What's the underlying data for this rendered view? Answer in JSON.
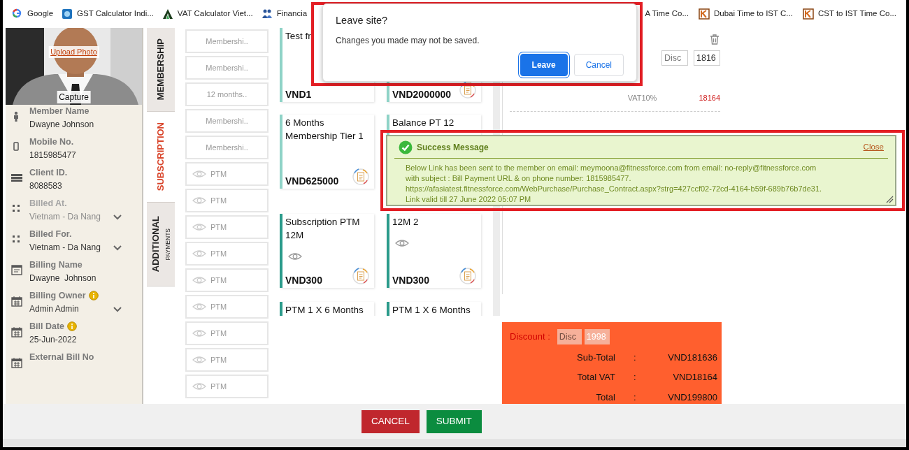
{
  "bookmarks": {
    "before_dialog": [
      {
        "label": "Google",
        "kind": "g"
      },
      {
        "label": "GST Calculator Indi...",
        "kind": "badge"
      },
      {
        "label": "VAT Calculator Viet...",
        "kind": "triangle"
      },
      {
        "label": "Financia",
        "kind": "people"
      }
    ],
    "after_dialog": [
      {
        "label": "A Time Co...",
        "kind": "none"
      },
      {
        "label": "Dubai Time to IST C...",
        "kind": "square"
      },
      {
        "label": "CST to IST Time Co...",
        "kind": "square"
      }
    ]
  },
  "profile": {
    "upload_link": "Upload Photo",
    "capture": "Capture"
  },
  "member_fields": [
    {
      "kind": "person",
      "label": "Member Name",
      "value": "Dwayne Johnson",
      "dropdown": false,
      "disabled": false,
      "info": false
    },
    {
      "kind": "phone",
      "label": "Mobile No.",
      "value": "1815985477",
      "dropdown": false,
      "disabled": false,
      "info": false
    },
    {
      "kind": "id",
      "label": "Client ID.",
      "value": "8088583",
      "dropdown": false,
      "disabled": false,
      "info": false
    },
    {
      "kind": "dots",
      "label": "Billed At.",
      "value": "Vietnam - Da Nang",
      "dropdown": true,
      "disabled": true,
      "info": false
    },
    {
      "kind": "dots",
      "label": "Billed For.",
      "value": "Vietnam - Da Nang",
      "dropdown": true,
      "disabled": false,
      "info": false
    },
    {
      "kind": "form",
      "label": "Billing Name",
      "value": "Dwayne  Johnson",
      "dropdown": false,
      "disabled": false,
      "info": false
    },
    {
      "kind": "calendar",
      "label": "Billing Owner",
      "value": "Admin Admin",
      "dropdown": true,
      "disabled": false,
      "info": true
    },
    {
      "kind": "calendar",
      "label": "Bill Date",
      "value": "25-Jun-2022",
      "dropdown": false,
      "disabled": false,
      "info": true
    },
    {
      "kind": "calendar",
      "label": "External Bill No",
      "disabled": false,
      "info": false
    }
  ],
  "tabs": [
    {
      "label": "MEMBERSHIP",
      "selected": false
    },
    {
      "label": "SUBSCRIPTION",
      "selected": true
    },
    {
      "label": "ADDITIONAL",
      "sublabel": "PAYMENTS",
      "selected": false
    }
  ],
  "category_buttons": [
    {
      "label": "Membershi..",
      "eye": false
    },
    {
      "label": "Membershi..",
      "eye": false
    },
    {
      "label": "12 months..",
      "eye": false
    },
    {
      "label": "Membershi..",
      "eye": false
    },
    {
      "label": "Membershi..",
      "eye": false
    },
    {
      "label": "PTM",
      "eye": true
    },
    {
      "label": "PTM",
      "eye": true
    },
    {
      "label": "PTM",
      "eye": true
    },
    {
      "label": "PTM",
      "eye": true
    },
    {
      "label": "PTM",
      "eye": true
    },
    {
      "label": "PTM",
      "eye": true
    },
    {
      "label": "PTM",
      "eye": true
    },
    {
      "label": "PTM",
      "eye": true
    },
    {
      "label": "PTM",
      "eye": true
    }
  ],
  "plan_cards": [
    {
      "title": "Test fr",
      "price": "VND1",
      "color": "#8fd3c7",
      "eye": false,
      "doc": false
    },
    {
      "price": "VND2000000",
      "color": "#8fd3c7",
      "eye": false,
      "doc": true
    },
    {
      "title": "6 Months Membership Tier 1",
      "price": "VND625000",
      "color": "#8fd3c7",
      "eye": false,
      "doc": true
    },
    {
      "title": "Balance PT 12",
      "color": "#8fd3c7"
    },
    {
      "title": "Subscription PTM 12M",
      "price": "VND300",
      "color": "#2b9b8b",
      "eye": true,
      "doc": true
    },
    {
      "title": "12M 2",
      "price": "VND300",
      "color": "#2b9b8b",
      "eye": true,
      "doc": true
    },
    {
      "title": "PTM 1 X 6 Months",
      "color": "#2b9b8b"
    },
    {
      "title": "PTM 1 X 6 Months",
      "color": "#2b9b8b"
    }
  ],
  "line_item": {
    "discount_placeholder": "Disc",
    "amount": "1816",
    "vat_label": "VAT10%",
    "vat_value": "18164"
  },
  "totals": {
    "discount_label": "Discount :",
    "discount_placeholder": "Disc",
    "discount_value": "1998",
    "rows": [
      {
        "label": "Sub-Total",
        "separator": ":",
        "value": "VND181636"
      },
      {
        "label": "Total VAT",
        "separator": ":",
        "value": "VND18164"
      },
      {
        "label": "Total",
        "separator": ":",
        "value": "VND199800"
      }
    ]
  },
  "footer_buttons": [
    {
      "label": "CANCEL",
      "kind": "danger"
    },
    {
      "label": "SUBMIT",
      "kind": "success"
    }
  ],
  "leave_dialog": {
    "title": "Leave site?",
    "message": "Changes you made may not be saved.",
    "buttons": [
      {
        "label": "Leave",
        "kind": "primary",
        "focused": true
      },
      {
        "label": "Cancel",
        "kind": "secondary",
        "focused": false
      }
    ]
  },
  "success_message": {
    "title": "Success Message",
    "close": "Close",
    "lines": [
      "Below Link has been sent to the member on email: meymoona@fitnessforce.com from email: no-reply@fitnessforce.com",
      "with subject : Bill Payment URL & on phone number: 1815985477.",
      "https://afasiatest.fitnessforce.com/WebPurchase/Purchase_Contract.aspx?strg=427ccf02-72cd-4164-b59f-689b76b7de31.",
      "Link valid till 27 June 2022 05:07 PM"
    ]
  }
}
